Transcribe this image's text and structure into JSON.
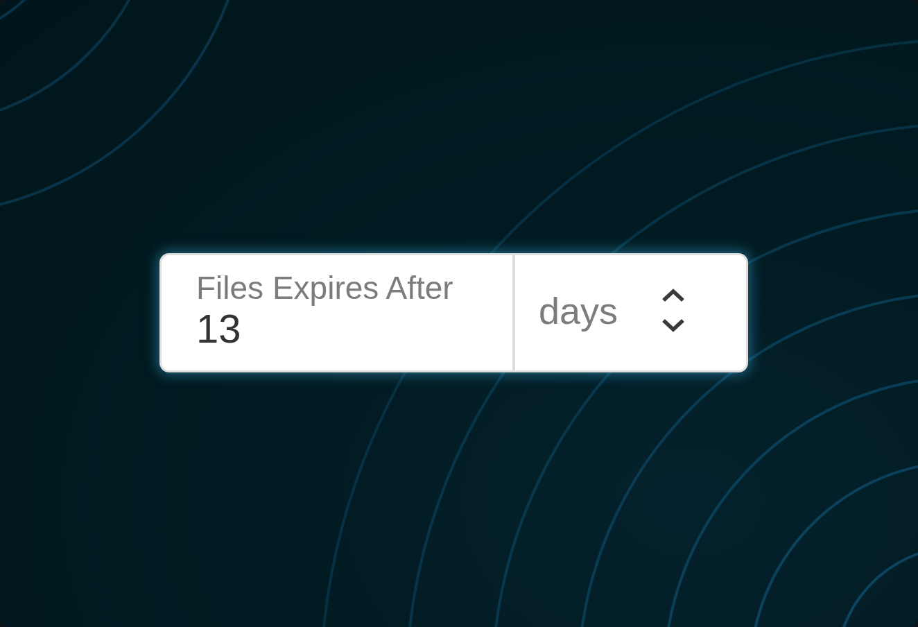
{
  "field": {
    "label": "Files Expires After",
    "value": "13"
  },
  "unit_select": {
    "value": "days"
  }
}
